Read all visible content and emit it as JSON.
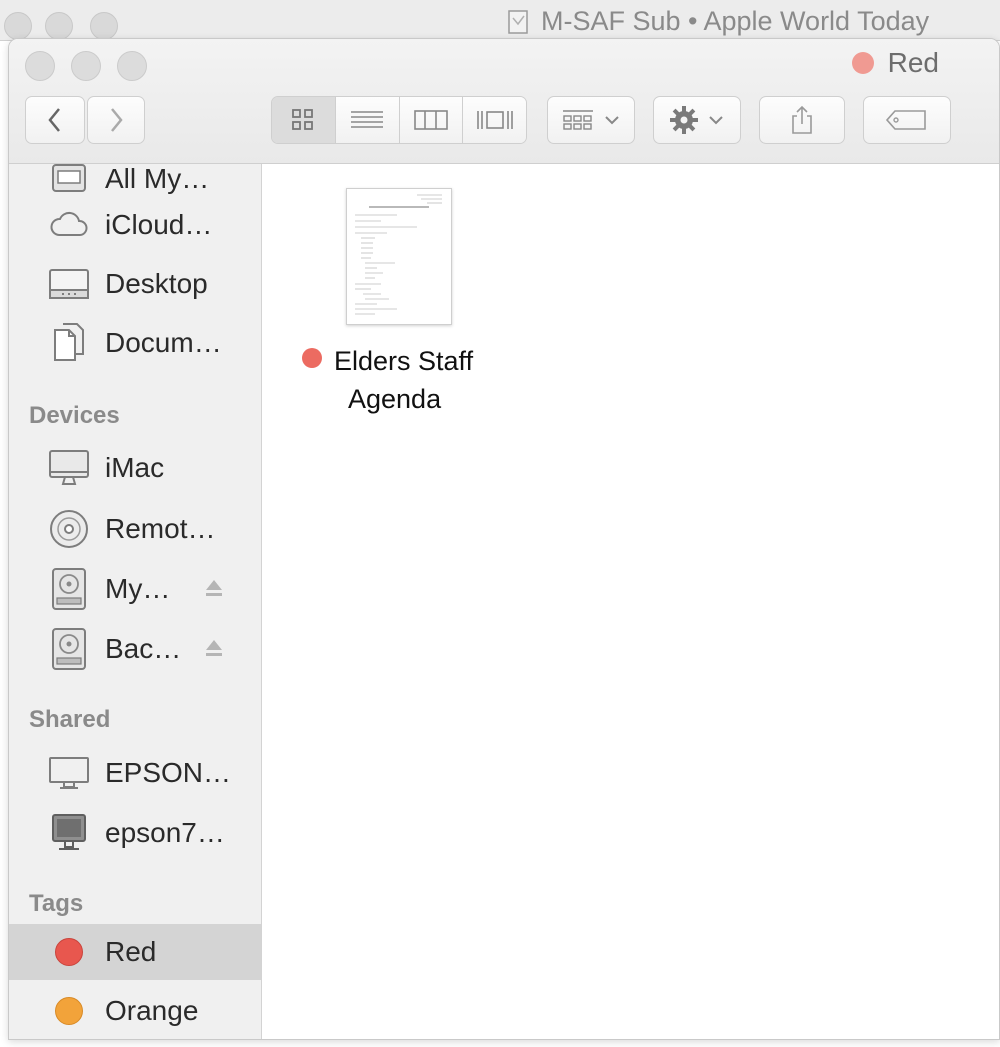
{
  "background_window": {
    "title": "M-SAF Sub • Apple World Today"
  },
  "window": {
    "tag_label": "Red",
    "tag_color": "#f09a92"
  },
  "toolbar": {
    "back_icon": "chevron-left-icon",
    "forward_icon": "chevron-right-icon",
    "view_modes": [
      "icon-view-icon",
      "list-view-icon",
      "column-view-icon",
      "cover-flow-icon"
    ],
    "active_view": "icon-view-icon",
    "arrange_icon": "arrange-grid-icon",
    "action_icon": "gear-icon",
    "share_icon": "share-icon",
    "tag_icon": "tag-icon"
  },
  "sidebar": {
    "favorites": [
      {
        "label": "All My…",
        "icon": "all-files-icon"
      },
      {
        "label": "iCloud…",
        "icon": "cloud-icon"
      },
      {
        "label": "Desktop",
        "icon": "desktop-icon"
      },
      {
        "label": "Docum…",
        "icon": "documents-icon"
      }
    ],
    "devices_header": "Devices",
    "devices": [
      {
        "label": "iMac",
        "icon": "imac-icon",
        "eject": false
      },
      {
        "label": "Remot…",
        "icon": "disc-icon",
        "eject": false
      },
      {
        "label": "My…",
        "icon": "hard-drive-icon",
        "eject": true
      },
      {
        "label": "Bac…",
        "icon": "hard-drive-icon",
        "eject": true
      }
    ],
    "shared_header": "Shared",
    "shared": [
      {
        "label": "EPSON…",
        "icon": "display-icon"
      },
      {
        "label": "epson7…",
        "icon": "display-icon"
      }
    ],
    "tags_header": "Tags",
    "tags": [
      {
        "label": "Red",
        "color": "#e8574e",
        "selected": true
      },
      {
        "label": "Orange",
        "color": "#f2a33a",
        "selected": false
      }
    ]
  },
  "content": {
    "files": [
      {
        "name_line1": "Elders Staff",
        "name_line2": "Agenda",
        "tag_color": "#ec6b61"
      }
    ]
  }
}
